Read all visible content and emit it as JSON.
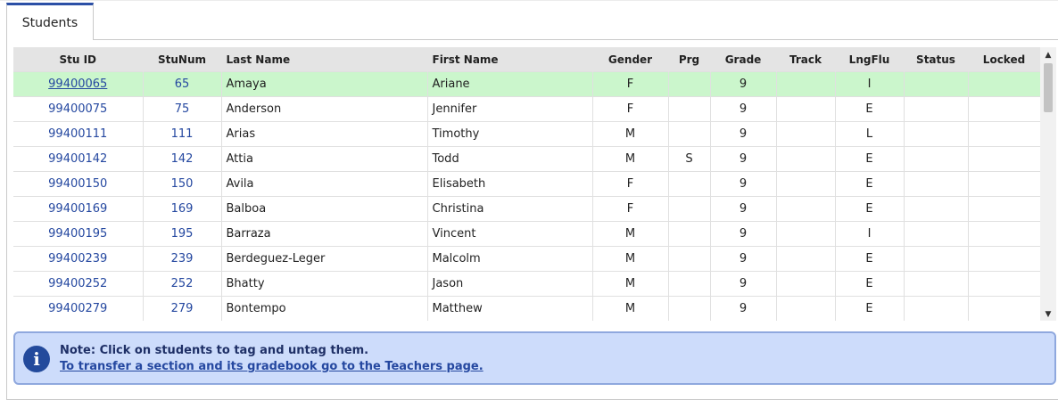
{
  "tabs": [
    {
      "label": "Students",
      "active": true
    }
  ],
  "columns": [
    "Stu ID",
    "StuNum",
    "Last Name",
    "First Name",
    "Gender",
    "Prg",
    "Grade",
    "Track",
    "LngFlu",
    "Status",
    "Locked"
  ],
  "rows": [
    {
      "stu_id": "99400065",
      "stu_num": "65",
      "last": "Amaya",
      "first": "Ariane",
      "gender": "F",
      "prg": "",
      "grade": "9",
      "track": "",
      "lngflu": "I",
      "status": "",
      "locked": "",
      "selected": true
    },
    {
      "stu_id": "99400075",
      "stu_num": "75",
      "last": "Anderson",
      "first": "Jennifer",
      "gender": "F",
      "prg": "",
      "grade": "9",
      "track": "",
      "lngflu": "E",
      "status": "",
      "locked": ""
    },
    {
      "stu_id": "99400111",
      "stu_num": "111",
      "last": "Arias",
      "first": "Timothy",
      "gender": "M",
      "prg": "",
      "grade": "9",
      "track": "",
      "lngflu": "L",
      "status": "",
      "locked": ""
    },
    {
      "stu_id": "99400142",
      "stu_num": "142",
      "last": "Attia",
      "first": "Todd",
      "gender": "M",
      "prg": "S",
      "grade": "9",
      "track": "",
      "lngflu": "E",
      "status": "",
      "locked": ""
    },
    {
      "stu_id": "99400150",
      "stu_num": "150",
      "last": "Avila",
      "first": "Elisabeth",
      "gender": "F",
      "prg": "",
      "grade": "9",
      "track": "",
      "lngflu": "E",
      "status": "",
      "locked": ""
    },
    {
      "stu_id": "99400169",
      "stu_num": "169",
      "last": "Balboa",
      "first": "Christina",
      "gender": "F",
      "prg": "",
      "grade": "9",
      "track": "",
      "lngflu": "E",
      "status": "",
      "locked": ""
    },
    {
      "stu_id": "99400195",
      "stu_num": "195",
      "last": "Barraza",
      "first": "Vincent",
      "gender": "M",
      "prg": "",
      "grade": "9",
      "track": "",
      "lngflu": "I",
      "status": "",
      "locked": ""
    },
    {
      "stu_id": "99400239",
      "stu_num": "239",
      "last": "Berdeguez-Leger",
      "first": "Malcolm",
      "gender": "M",
      "prg": "",
      "grade": "9",
      "track": "",
      "lngflu": "E",
      "status": "",
      "locked": ""
    },
    {
      "stu_id": "99400252",
      "stu_num": "252",
      "last": "Bhatty",
      "first": "Jason",
      "gender": "M",
      "prg": "",
      "grade": "9",
      "track": "",
      "lngflu": "E",
      "status": "",
      "locked": ""
    },
    {
      "stu_id": "99400279",
      "stu_num": "279",
      "last": "Bontempo",
      "first": "Matthew",
      "gender": "M",
      "prg": "",
      "grade": "9",
      "track": "",
      "lngflu": "E",
      "status": "",
      "locked": ""
    }
  ],
  "scroll": {
    "up_glyph": "▲",
    "down_glyph": "▼"
  },
  "note": {
    "icon": "info-icon",
    "icon_glyph": "i",
    "line1": "Note: Click on students to tag and untag them.",
    "link": "To transfer a section and its gradebook go to the Teachers page."
  },
  "colors": {
    "accent": "#2b4fa6",
    "selected_row": "#cbf6cc",
    "link": "#2548a0",
    "note_bg": "#cddcfb",
    "header_bg": "#e4e4e4"
  }
}
